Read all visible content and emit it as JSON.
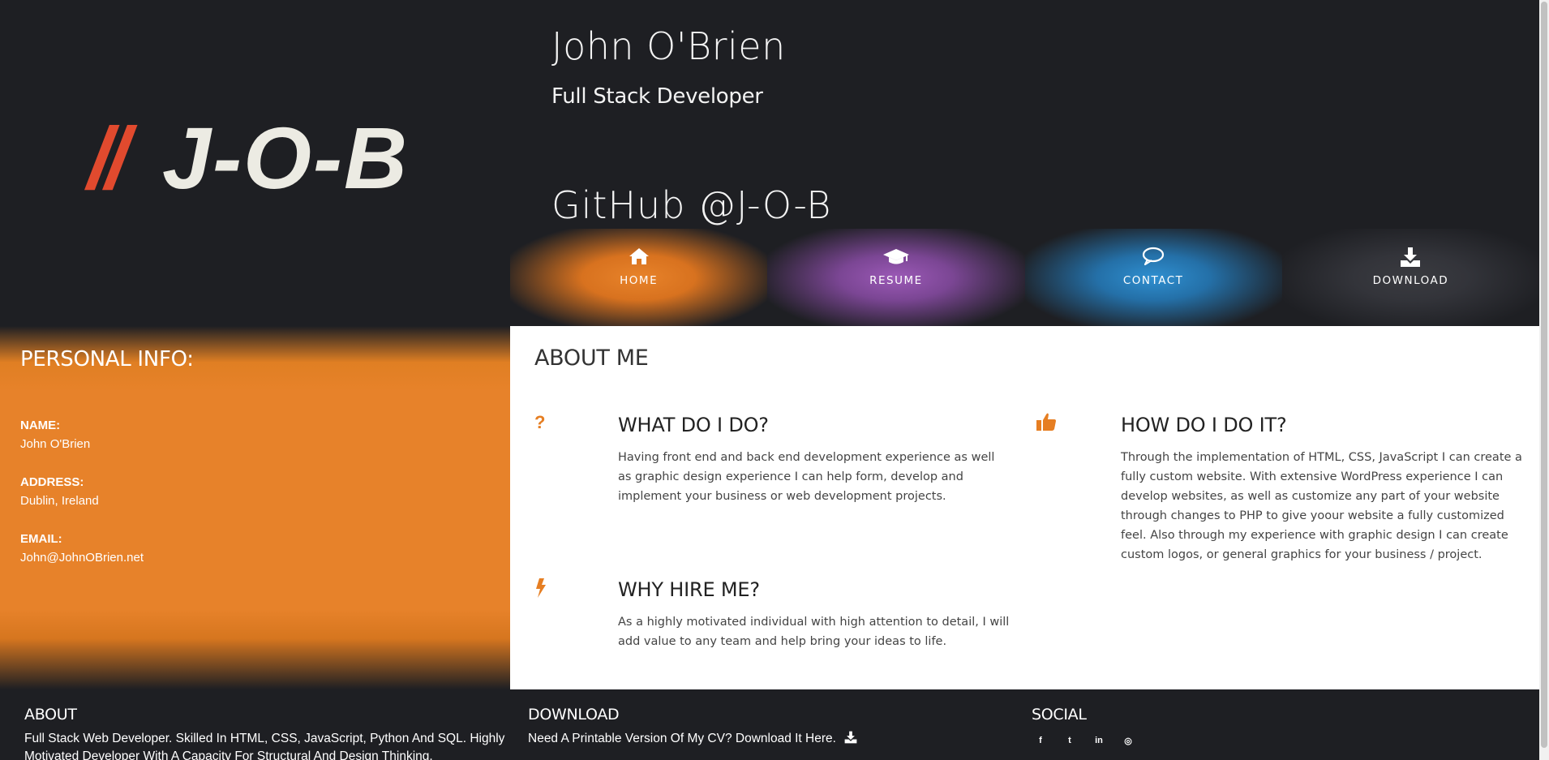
{
  "header": {
    "logo": {
      "slashes": "//",
      "word": "J-O-B"
    },
    "name": "John O'Brien",
    "role": "Full Stack Developer",
    "github": "GitHub @J-O-B"
  },
  "nav": [
    {
      "label": "HOME",
      "icon": "home-icon",
      "color": "#e8832a"
    },
    {
      "label": "RESUME",
      "icon": "graduation-cap-icon",
      "color": "#9b59b6"
    },
    {
      "label": "CONTACT",
      "icon": "speech-bubble-icon",
      "color": "#2f8fd0"
    },
    {
      "label": "DOWNLOAD",
      "icon": "download-icon",
      "color": "#3a3b40"
    }
  ],
  "personal": {
    "title": "PERSONAL INFO:",
    "name_label": "NAME:",
    "name_value": "John O'Brien",
    "address_label": "ADDRESS:",
    "address_value": "Dublin, Ireland",
    "email_label": "EMAIL:",
    "email_value": "John@JohnOBrien.net"
  },
  "about": {
    "title": "ABOUT ME",
    "features": [
      {
        "icon": "question-icon",
        "title": "WHAT DO I DO?",
        "text": "Having front end and back end development experience as well as graphic design experience I can help form, develop and implement your business or web development projects."
      },
      {
        "icon": "thumbs-up-icon",
        "title": "HOW DO I DO IT?",
        "text": "Through the implementation of HTML, CSS, JavaScript I can create a fully custom website. With extensive WordPress experience I can develop websites, as well as customize any part of your website through changes to PHP to give yoour website a fully customized feel. Also through my experience with graphic design I can create custom logos, or general graphics for your business / project."
      },
      {
        "icon": "bolt-icon",
        "title": "WHY HIRE ME?",
        "text": "As a highly motivated individual with high attention to detail, I will add value to any team and help bring your ideas to life."
      }
    ],
    "accent": "#e67e22"
  },
  "footer": {
    "about_title": "ABOUT",
    "about_text": "Full Stack Web Developer. Skilled In HTML, CSS, JavaScript, Python And SQL. Highly Motivated Developer With A Capacity For Structural And Design Thinking.",
    "download_title": "DOWNLOAD",
    "download_text": "Need A Printable Version Of My CV? Download It Here.",
    "social_title": "SOCIAL",
    "social": [
      {
        "icon": "facebook-icon",
        "glyph": "f"
      },
      {
        "icon": "twitter-icon",
        "glyph": "t"
      },
      {
        "icon": "linkedin-icon",
        "glyph": "in"
      },
      {
        "icon": "instagram-icon",
        "glyph": "◎"
      }
    ]
  }
}
